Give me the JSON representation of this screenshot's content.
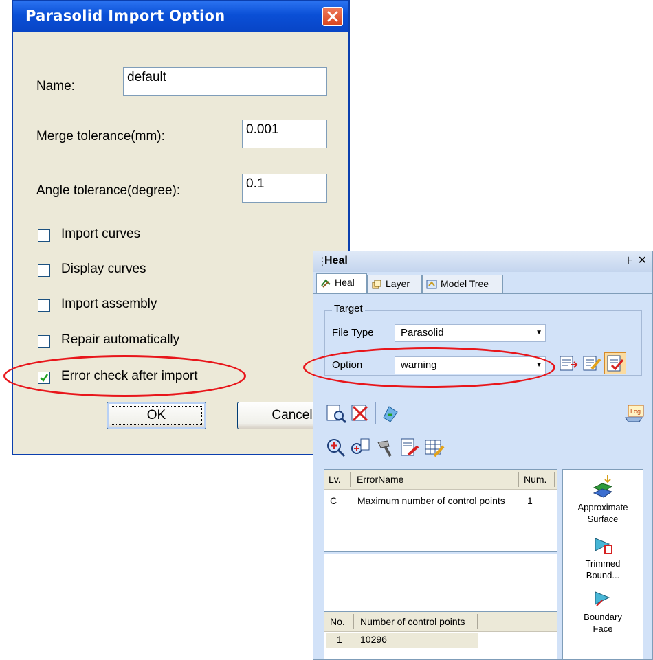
{
  "dialog": {
    "title": "Parasolid Import Option",
    "name_label": "Name:",
    "name_value": "default",
    "merge_label": "Merge tolerance(mm):",
    "merge_value": "0.001",
    "angle_label": "Angle tolerance(degree):",
    "angle_value": "0.1",
    "checkboxes": [
      {
        "label": "Import curves",
        "checked": false
      },
      {
        "label": "Display curves",
        "checked": false
      },
      {
        "label": "Import assembly",
        "checked": false
      },
      {
        "label": "Repair automatically",
        "checked": false
      },
      {
        "label": "Error check after import",
        "checked": true
      }
    ],
    "ok_label": "OK",
    "cancel_label": "Cancel"
  },
  "heal": {
    "title": "Heal",
    "pin_glyph": "Ͱ",
    "close_glyph": "✕",
    "tabs": [
      {
        "label": "Heal",
        "icon": "heal-icon",
        "active": true
      },
      {
        "label": "Layer",
        "icon": "layer-icon",
        "active": false
      },
      {
        "label": "Model Tree",
        "icon": "model-tree-icon",
        "active": false
      }
    ],
    "target_legend": "Target",
    "file_type_label": "File Type",
    "file_type_value": "Parasolid",
    "option_label": "Option",
    "option_value": "warning",
    "error_table": {
      "headers": [
        "Lv.",
        "ErrorName",
        "Num."
      ],
      "rows": [
        [
          "C",
          "Maximum number of control points",
          "1"
        ]
      ]
    },
    "detail_table": {
      "headers": [
        "No.",
        "Number of control points"
      ],
      "rows": [
        [
          "1",
          "10296"
        ]
      ]
    },
    "side_tools": [
      {
        "label": "Approximate Surface",
        "line1": "Approximate",
        "line2": "Surface",
        "icon": "approximate-surface-icon"
      },
      {
        "label": "Trimmed Bound...",
        "line1": "Trimmed",
        "line2": "Bound...",
        "icon": "trimmed-boundary-icon"
      },
      {
        "label": "Boundary Face",
        "line1": "Boundary",
        "line2": "Face",
        "icon": "boundary-face-icon"
      }
    ]
  },
  "colors": {
    "highlight_ellipse": "#e8161b",
    "dialog_title": "#0a4fd6",
    "panel_bg": "#d2e2f8"
  }
}
